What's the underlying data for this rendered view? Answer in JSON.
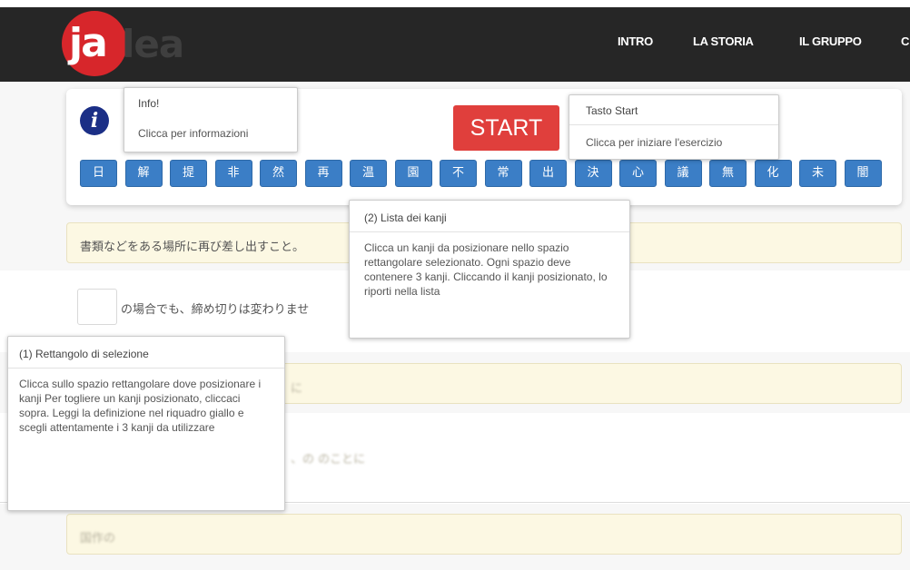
{
  "brand": {
    "logo_part1": "ja",
    "logo_part2": "lea"
  },
  "nav": {
    "items": [
      {
        "label": "INTRO"
      },
      {
        "label": "LA STORIA"
      },
      {
        "label": "IL GRUPPO"
      },
      {
        "label": "C"
      }
    ]
  },
  "toolbar": {
    "info_icon": "info-circle-icon",
    "start_label": "START"
  },
  "kanji_list": [
    "日",
    "解",
    "提",
    "非",
    "然",
    "再",
    "温",
    "園",
    "不",
    "常",
    "出",
    "決",
    "心",
    "議",
    "無",
    "化",
    "未",
    "闇"
  ],
  "definitions": [
    {
      "text": "書類などをある場所に再び差し出すこと。",
      "blurred": false
    },
    {
      "text": "の場合でも、締め切りは変わりませ",
      "blurred": false
    },
    {
      "text": "に",
      "blurred": true
    },
    {
      "text": "、の のことに",
      "blurred": true
    },
    {
      "text": "国作の",
      "blurred": true
    }
  ],
  "tooltips": {
    "info": {
      "title": "Info!",
      "body": "Clicca per informazioni"
    },
    "start": {
      "title": "Tasto Start",
      "body": "Clicca per iniziare l'esercizio"
    },
    "kanji_list": {
      "title": "(2) Lista dei kanji",
      "body": "Clicca un kanji da posizionare nello spazio rettangolare selezionato. Ogni spazio deve contenere 3 kanji. Cliccando il kanji posizionato, lo riporti nella lista"
    },
    "selection": {
      "title": "(1) Rettangolo di selezione",
      "body": "Clicca sullo spazio rettangolare dove posizionare i kanji Per togliere un kanji posizionato, cliccaci sopra. Leggi la definizione nel riquadro giallo e scegli attentamente i 3 kanji da utilizzare"
    }
  },
  "colors": {
    "navbar": "#262626",
    "logo_red": "#d7262b",
    "start_red": "#e03f3c",
    "kanji_blue": "#3b7ec6",
    "info_blue": "#1b2f86",
    "definition_yellow": "#fcf8e3"
  }
}
